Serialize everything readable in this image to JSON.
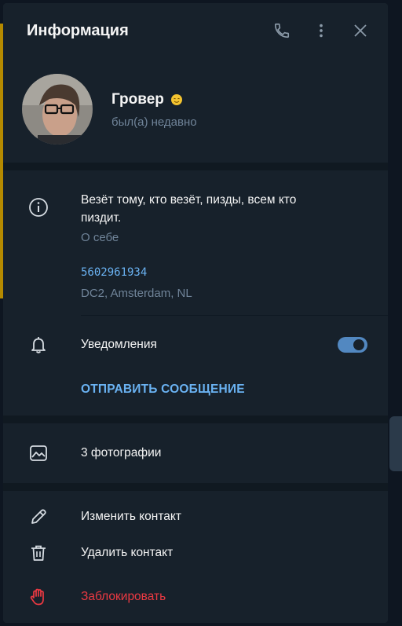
{
  "header": {
    "title": "Информация"
  },
  "profile": {
    "name": "Гровер",
    "status": "был(а) недавно"
  },
  "info": {
    "bio": "Везёт тому, кто везёт, пизды, всем кто пиздит.",
    "bio_label": "О себе",
    "user_id": "5602961934",
    "dc": "DC2, Amsterdam, NL"
  },
  "notifications": {
    "label": "Уведомления",
    "enabled": true,
    "send_message": "ОТПРАВИТЬ СООБЩЕНИЕ"
  },
  "media": {
    "photos": "3 фотографии"
  },
  "actions": {
    "edit": "Изменить контакт",
    "delete": "Удалить контакт",
    "block": "Заблокировать"
  },
  "colors": {
    "panel": "#17212b",
    "accent": "#5288c1",
    "link": "#6ab2f2",
    "danger": "#ec3942",
    "muted": "#708499"
  }
}
